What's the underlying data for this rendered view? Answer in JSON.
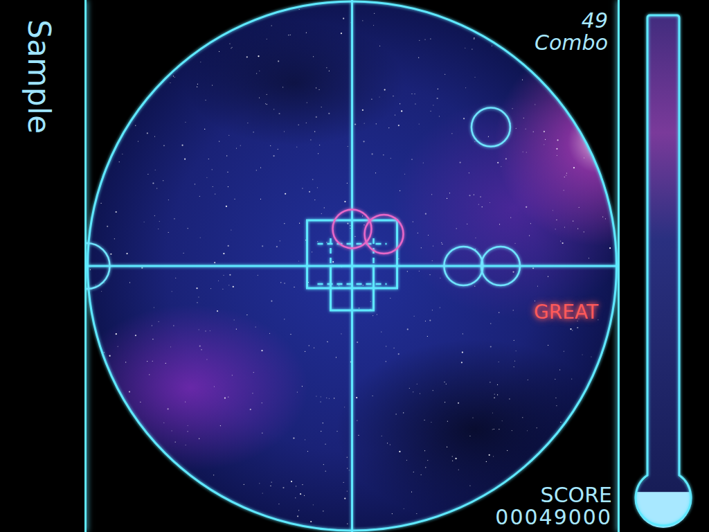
{
  "song": {
    "title": "Sample"
  },
  "combo": {
    "count": "49",
    "label": "Combo"
  },
  "judgement": {
    "text": "GREAT",
    "color": "#ff5a5a"
  },
  "score": {
    "label": "SCORE",
    "value": "00049000"
  },
  "gauge": {
    "level": 0.07
  },
  "notes": [
    {
      "angle": 45,
      "distance": 0.74,
      "color": "#6fe4ff"
    },
    {
      "angle": 0,
      "distance": 0.42,
      "color": "#6fe4ff"
    },
    {
      "angle": 0,
      "distance": 0.56,
      "color": "#6fe4ff"
    },
    {
      "angle": 180,
      "distance": 1.0,
      "color": "#6fe4ff"
    },
    {
      "angle": 90,
      "distance": 0.14,
      "color": "#e868c8"
    },
    {
      "angle": 45,
      "distance": 0.17,
      "color": "#e868c8"
    }
  ]
}
